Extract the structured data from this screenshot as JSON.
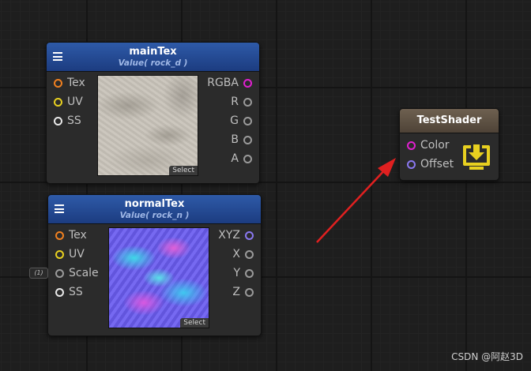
{
  "nodes": {
    "main_tex": {
      "title": "mainTex",
      "subtitle": "Value( rock_d )",
      "inputs": [
        {
          "label": "Tex",
          "color": "#f08020"
        },
        {
          "label": "UV",
          "color": "#e8d020"
        },
        {
          "label": "SS",
          "color": "#e8e8e8"
        }
      ],
      "outputs": [
        {
          "label": "RGBA",
          "color": "#e020d0"
        },
        {
          "label": "R",
          "color": "#9a9a9a"
        },
        {
          "label": "G",
          "color": "#9a9a9a"
        },
        {
          "label": "B",
          "color": "#9a9a9a"
        },
        {
          "label": "A",
          "color": "#9a9a9a"
        }
      ],
      "preview_button": "Select"
    },
    "normal_tex": {
      "title": "normalTex",
      "subtitle": "Value( rock_n )",
      "inputs": [
        {
          "label": "Tex",
          "color": "#f08020"
        },
        {
          "label": "UV",
          "color": "#e8d020"
        },
        {
          "label": "Scale",
          "color": "#9a9a9a"
        },
        {
          "label": "SS",
          "color": "#e8e8e8"
        }
      ],
      "outputs": [
        {
          "label": "XYZ",
          "color": "#8a78f0"
        },
        {
          "label": "X",
          "color": "#9a9a9a"
        },
        {
          "label": "Y",
          "color": "#9a9a9a"
        },
        {
          "label": "Z",
          "color": "#9a9a9a"
        }
      ],
      "preview_button": "Select",
      "scale_default": "(1)"
    },
    "test_shader": {
      "title": "TestShader",
      "inputs": [
        {
          "label": "Color",
          "color": "#e020d0"
        },
        {
          "label": "Offset",
          "color": "#8a78f0"
        }
      ],
      "icon": "download-to-screen-icon",
      "icon_color": "#e8d020"
    }
  },
  "annotation": {
    "arrow_color": "#e02020"
  },
  "watermark": "CSDN @阿赵3D"
}
